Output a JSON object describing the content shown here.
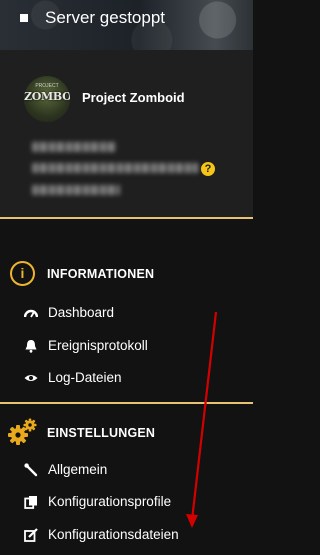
{
  "status": {
    "text": "Server gestoppt"
  },
  "server": {
    "name": "Project Zomboid",
    "avatar_text": "ZOMBOID",
    "avatar_small_text": "PROJECT"
  },
  "sections": {
    "information": {
      "title": "INFORMATIONEN",
      "items": [
        "Dashboard",
        "Ereignisprotokoll",
        "Log-Dateien"
      ]
    },
    "settings": {
      "title": "EINSTELLUNGEN",
      "items": [
        "Allgemein",
        "Konfigurationsprofile",
        "Konfigurationsdateien"
      ]
    }
  },
  "colors": {
    "accent": "#e9c172",
    "info_icon": "#f0b530",
    "gear": "#e8a91c",
    "help_badge": "#f5c518",
    "annotation_arrow": "#d40000"
  },
  "icons": {
    "info": "info-icon",
    "settings": "gears-icon",
    "dashboard": "gauge-icon",
    "events": "bell-icon",
    "logs": "eye-icon",
    "general": "wrench-icon",
    "profiles": "copy-icon",
    "files": "edit-icon"
  }
}
